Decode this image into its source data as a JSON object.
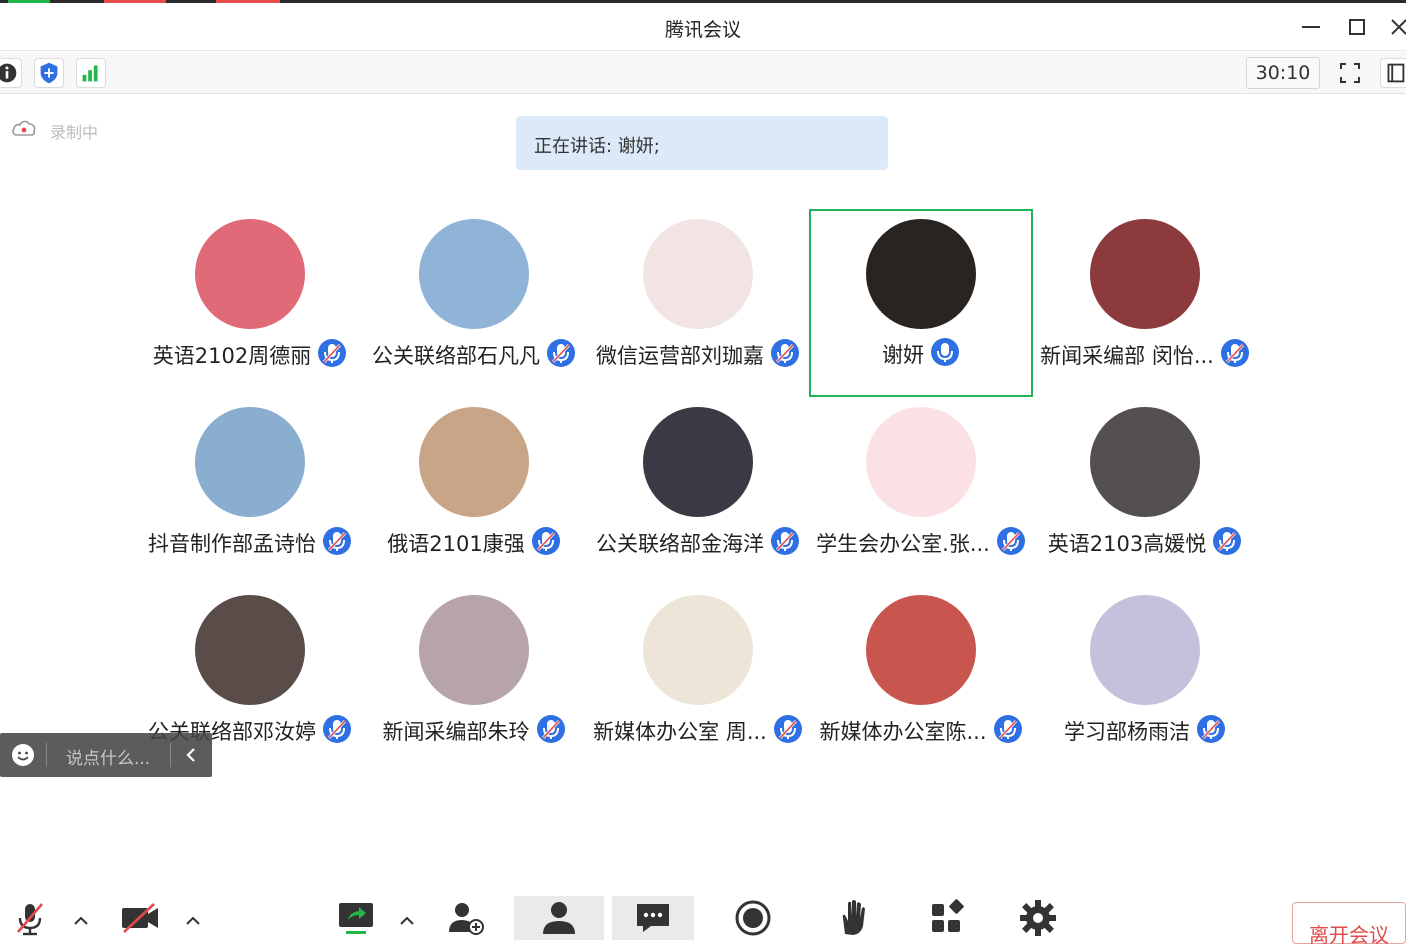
{
  "window": {
    "title": "腾讯会议"
  },
  "toolbar": {
    "timer": "30:10"
  },
  "recording": {
    "label": "录制中"
  },
  "speaking": {
    "text": "正在讲话: 谢妍;"
  },
  "participants": [
    {
      "name": "英语2102周德丽",
      "avatar_color": "#e06a78",
      "mic": "muted"
    },
    {
      "name": "公关联络部石凡凡",
      "avatar_color": "#8fb4d8",
      "mic": "muted"
    },
    {
      "name": "微信运营部刘珈嘉",
      "avatar_color": "#f1e4e2",
      "mic": "muted"
    },
    {
      "name": "谢妍",
      "avatar_color": "#2a2420",
      "mic": "active"
    },
    {
      "name": "新闻采编部 闵怡...",
      "avatar_color": "#8c3a3c",
      "mic": "muted"
    },
    {
      "name": "抖音制作部孟诗怡",
      "avatar_color": "#8aaed0",
      "mic": "muted"
    },
    {
      "name": "俄语2101康强",
      "avatar_color": "#c8a586",
      "mic": "muted"
    },
    {
      "name": "公关联络部金海洋",
      "avatar_color": "#3b3a44",
      "mic": "muted"
    },
    {
      "name": "学生会办公室.张...",
      "avatar_color": "#fce1e4",
      "mic": "muted"
    },
    {
      "name": "英语2103高媛悦",
      "avatar_color": "#54504f",
      "mic": "muted"
    },
    {
      "name": "公关联络部邓汝婷",
      "avatar_color": "#5a4c48",
      "mic": "muted"
    },
    {
      "name": "新闻采编部朱玲",
      "avatar_color": "#b7a3ac",
      "mic": "muted"
    },
    {
      "name": "新媒体办公室 周...",
      "avatar_color": "#ede6d8",
      "mic": "muted"
    },
    {
      "name": "新媒体办公室陈...",
      "avatar_color": "#c9554f",
      "mic": "muted"
    },
    {
      "name": "学习部杨雨洁",
      "avatar_color": "#c6c0dc",
      "mic": "muted"
    }
  ],
  "chat": {
    "placeholder": "说点什么..."
  },
  "bottom": {
    "leave_label": "离开会议"
  },
  "colors": {
    "accent_blue": "#2f6fe4",
    "active_border": "#20b15a",
    "leave_red": "#e24b4b"
  }
}
